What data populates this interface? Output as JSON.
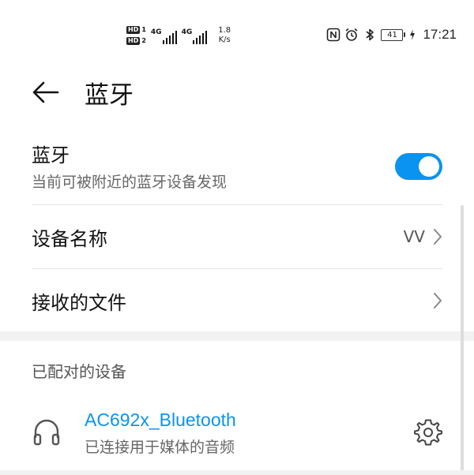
{
  "status_bar": {
    "sim1_label": "HD",
    "sim1_num": "1",
    "sim2_label": "HD",
    "sim2_num": "2",
    "net1": "4G",
    "net2": "4G",
    "speed_value": "1.8",
    "speed_unit": "K/s",
    "battery": "41",
    "time": "17:21",
    "icons": [
      "nfc-icon",
      "alarm-icon",
      "bluetooth-icon",
      "battery-icon",
      "charging-icon"
    ]
  },
  "header": {
    "title": "蓝牙",
    "back_icon": "back-arrow-icon"
  },
  "bluetooth": {
    "title": "蓝牙",
    "subtitle": "当前可被附近的蓝牙设备发现",
    "enabled": true
  },
  "device_name": {
    "label": "设备名称",
    "value": "VV"
  },
  "received_files": {
    "label": "接收的文件"
  },
  "paired": {
    "header": "已配对的设备",
    "devices": [
      {
        "name": "AC692x_Bluetooth",
        "status": "已连接用于媒体的音频",
        "icon": "headphone-icon"
      }
    ]
  },
  "colors": {
    "accent": "#0a93f0",
    "text": "#111111",
    "secondary": "#666666",
    "divider": "#e5e5e5",
    "section_bg": "#f2f2f2"
  }
}
